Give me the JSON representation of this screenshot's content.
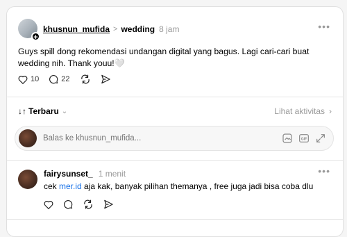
{
  "post": {
    "username": "khusnun_mufida",
    "separator": ">",
    "topic": "wedding",
    "time": "8 jam",
    "text": "Guys spill dong rekomendasi undangan digital yang bagus. Lagi cari-cari buat wedding nih. Thank youu!",
    "emoji": "🤍",
    "likes": "10",
    "comments": "22"
  },
  "sort": {
    "arrow": "↓↑",
    "label": "Terbaru",
    "activity_label": "Lihat aktivitas"
  },
  "reply": {
    "placeholder": "Balas ke khusnun_mufida..."
  },
  "comment": {
    "username": "fairysunset_",
    "time": "1 menit",
    "text_before": "cek ",
    "link": "mer.id",
    "text_after": " aja kak, banyak pilihan themanya , free juga jadi bisa coba dlu"
  },
  "icons": {
    "more": "more-icon",
    "heart": "heart-icon",
    "comment": "comment-icon",
    "repost": "repost-icon",
    "share": "send-icon",
    "sticker": "sticker-icon",
    "gif": "gif-icon",
    "expand": "expand-icon"
  },
  "colors": {
    "link": "#1a73e8",
    "muted": "#999999"
  }
}
